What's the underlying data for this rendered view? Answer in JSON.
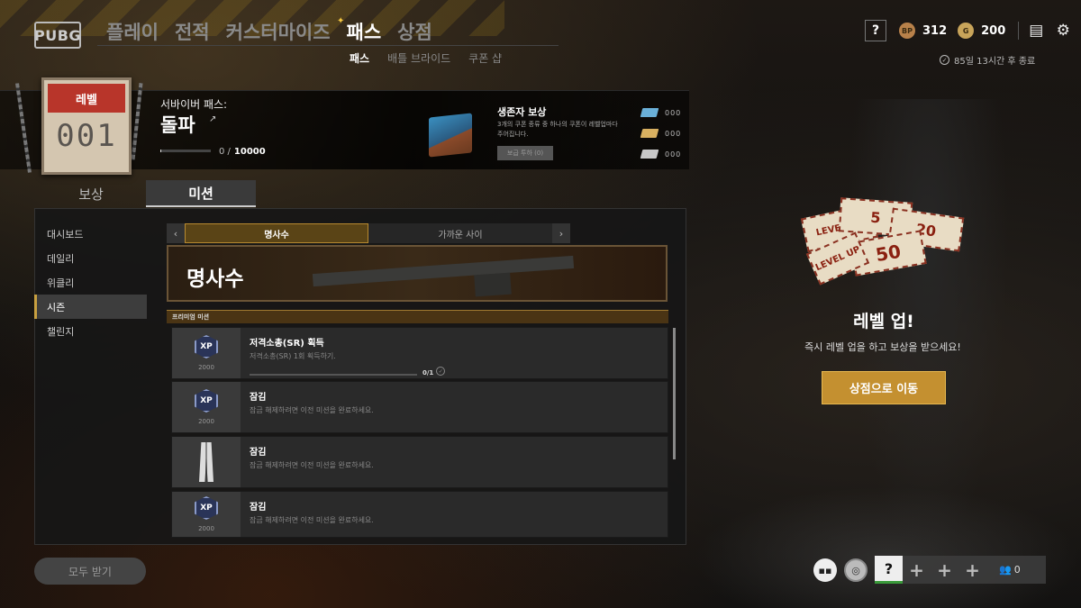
{
  "logo": "PUBG",
  "nav": {
    "items": [
      {
        "label": "플레이",
        "active": false
      },
      {
        "label": "전적",
        "active": false
      },
      {
        "label": "커스터마이즈",
        "active": false
      },
      {
        "label": "패스",
        "active": true
      },
      {
        "label": "상점",
        "active": false
      }
    ],
    "sub": [
      {
        "label": "패스",
        "active": true
      },
      {
        "label": "배틀 브라이드",
        "active": false
      },
      {
        "label": "쿠폰 샵",
        "active": false
      }
    ]
  },
  "topbar": {
    "help": "?",
    "bp_icon": "BP",
    "bp_value": "312",
    "g_icon": "G",
    "g_value": "200",
    "timer": "85일 13시간 후 종료"
  },
  "level": {
    "label": "레벨",
    "number": "001"
  },
  "pass": {
    "label": "서바이버 패스:",
    "name": "돌파",
    "progress_text": "0 /",
    "progress_max": "10000",
    "progress_fraction": 0.0
  },
  "reward": {
    "title": "생존자 보상",
    "desc": "3개의 쿠폰 종류 중 하나의 쿠폰이 레벨업마다 주어집니다.",
    "button": "보급 투하 (0)"
  },
  "tickets": [
    {
      "color": "#6ab0d8",
      "value": "000"
    },
    {
      "color": "#d8b060",
      "value": "000"
    },
    {
      "color": "#c8c8c8",
      "value": "000"
    }
  ],
  "tabs": [
    {
      "label": "보상",
      "active": false
    },
    {
      "label": "미션",
      "active": true
    }
  ],
  "sidebar": [
    {
      "label": "대시보드",
      "active": false
    },
    {
      "label": "데일리",
      "active": false
    },
    {
      "label": "위클리",
      "active": false
    },
    {
      "label": "시즌",
      "active": true
    },
    {
      "label": "챌린지",
      "active": false
    }
  ],
  "subtabs": [
    {
      "label": "명사수",
      "active": true
    },
    {
      "label": "가까운 사이",
      "active": false
    }
  ],
  "hero_title": "명사수",
  "premium_label": "프리미엄 미션",
  "missions": [
    {
      "icon": "XP",
      "points": "2000",
      "title": "저격소총(SR) 획득",
      "desc": "저격소총(SR) 1회 획득하기.",
      "count": "0/1",
      "progress": 0
    },
    {
      "icon": "XP",
      "points": "2000",
      "title": "잠김",
      "desc": "잠금 해제하려면 이전 미션을 완료하세요."
    },
    {
      "icon": "pants",
      "points": "",
      "title": "잠김",
      "desc": "잠금 해제하려면 이전 미션을 완료하세요."
    },
    {
      "icon": "XP",
      "points": "2000",
      "title": "잠김",
      "desc": "잠금 해제하려면 이전 미션을 완료하세요."
    }
  ],
  "claim_all": "모두 받기",
  "promo": {
    "ticket_labels": [
      "LEVEL UP",
      "5",
      "20",
      "50",
      "LEVEL UP"
    ],
    "title": "레벨 업!",
    "desc": "즉시 레벨 업을 하고 보상을 받으세요!",
    "button": "상점으로 이동"
  },
  "squad": {
    "slot_help": "?",
    "slot_add": "+",
    "people_count": "0"
  }
}
